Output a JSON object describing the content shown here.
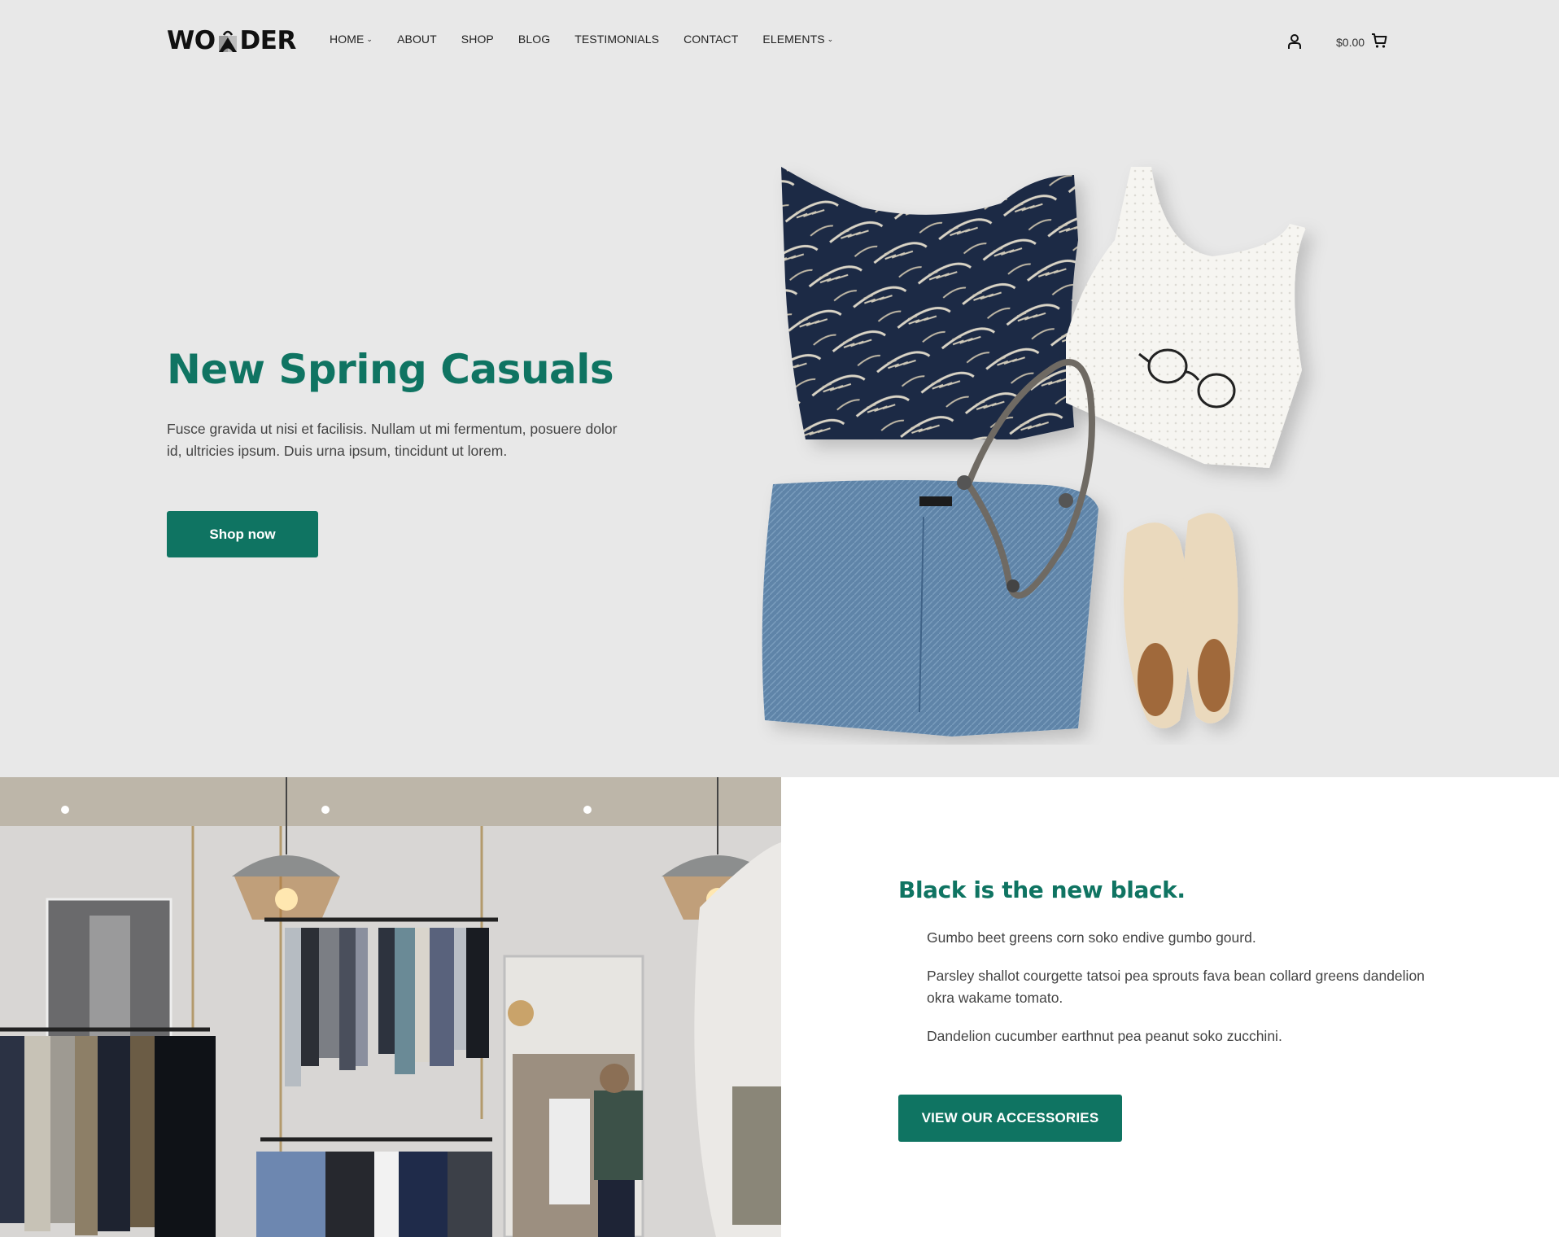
{
  "header": {
    "logo": {
      "text_left": "WO",
      "text_right": "DER"
    },
    "nav": [
      {
        "label": "HOME",
        "has_dropdown": true
      },
      {
        "label": "ABOUT",
        "has_dropdown": false
      },
      {
        "label": "SHOP",
        "has_dropdown": false
      },
      {
        "label": "BLOG",
        "has_dropdown": false
      },
      {
        "label": "TESTIMONIALS",
        "has_dropdown": false
      },
      {
        "label": "CONTACT",
        "has_dropdown": false
      },
      {
        "label": "ELEMENTS",
        "has_dropdown": true
      }
    ],
    "dropdown_glyph": "⌄",
    "account_icon": "user-icon",
    "cart": {
      "total": "$0.00",
      "icon": "cart-icon"
    }
  },
  "hero": {
    "title": "New Spring Casuals",
    "text": "Fusce gravida ut nisi et facilisis. Nullam ut mi fermentum, posuere dolor id, ultricies ipsum. Duis urna ipsum, tincidunt ut lorem.",
    "button_label": "Shop now",
    "image_alt": "Flat-lay of floral top, white knit tank, jeans, necklace, glasses and brogues"
  },
  "feature": {
    "image_alt": "Clothing store interior with hanging rails and pendant lamps",
    "title": "Black is the new black.",
    "paragraphs": [
      "Gumbo beet greens corn soko endive gumbo gourd.",
      "Parsley shallot courgette tatsoi pea sprouts fava bean collard greens dandelion okra wakame tomato.",
      "Dandelion cucumber earthnut pea peanut soko zucchini."
    ],
    "button_label": "VIEW OUR ACCESSORIES"
  },
  "colors": {
    "accent": "#0f7462",
    "hero_bg": "#e8e8e8",
    "panel_bg": "#ffffff"
  }
}
